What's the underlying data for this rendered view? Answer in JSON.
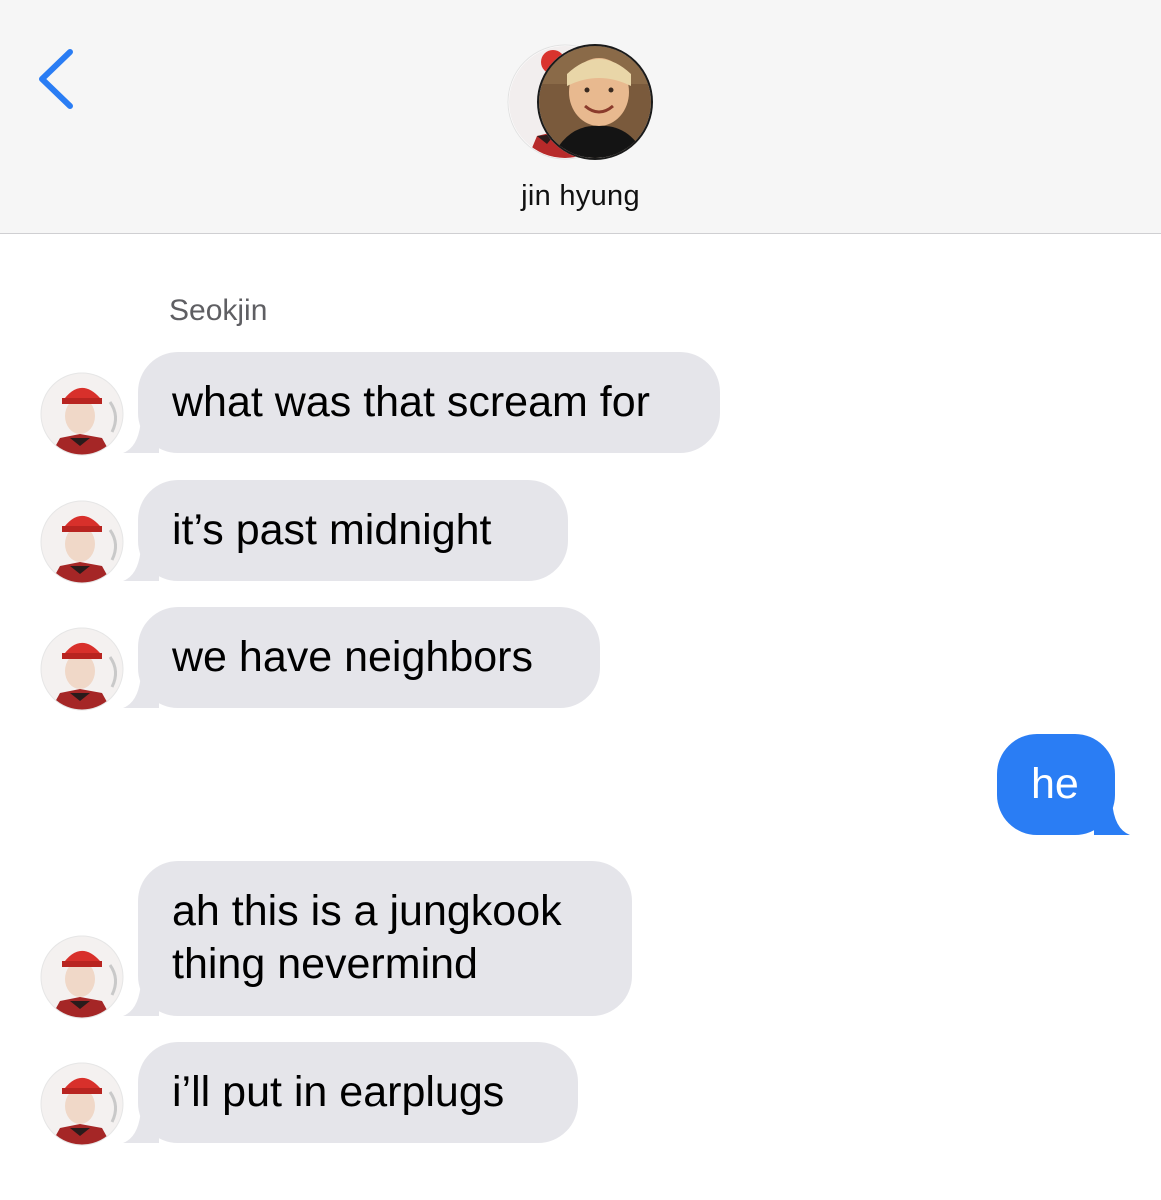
{
  "header": {
    "back_icon": "chevron-left-icon",
    "contact_name": "jin hyung"
  },
  "conversation": {
    "sender_label": "Seokjin",
    "messages": [
      {
        "direction": "incoming",
        "text": "what was that scream for"
      },
      {
        "direction": "incoming",
        "text": "it’s past midnight"
      },
      {
        "direction": "incoming",
        "text": "we have neighbors"
      },
      {
        "direction": "outgoing",
        "text": "he"
      },
      {
        "direction": "incoming",
        "lines": [
          "ah this is a jungkook",
          "thing nevermind"
        ]
      },
      {
        "direction": "incoming",
        "text": "i’ll put in earplugs"
      }
    ]
  },
  "colors": {
    "accent": "#2a7df4",
    "incoming_bubble": "#e5e5ea",
    "outgoing_bubble": "#2a7df4",
    "header_bg": "#f6f6f6"
  }
}
